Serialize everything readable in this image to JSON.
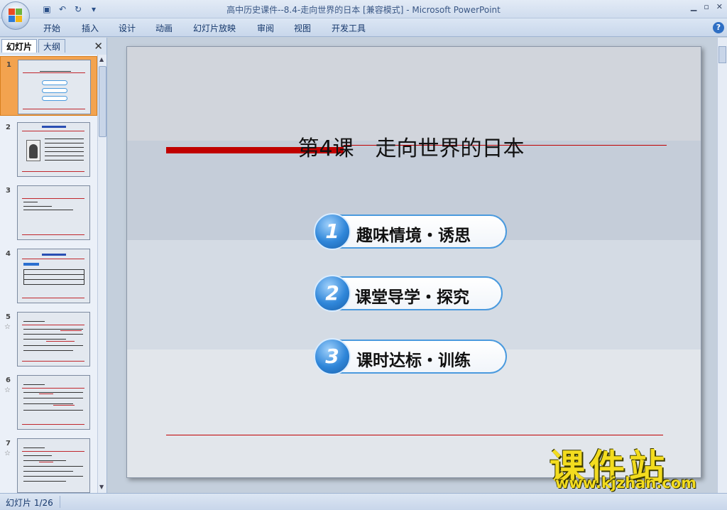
{
  "window": {
    "title": "高中历史课件--8.4-走向世界的日本 [兼容模式] - Microsoft PowerPoint"
  },
  "ribbon": {
    "tabs": [
      "开始",
      "插入",
      "设计",
      "动画",
      "幻灯片放映",
      "审阅",
      "视图",
      "开发工具"
    ]
  },
  "panel": {
    "tab_slides": "幻灯片",
    "tab_outline": "大纲",
    "close": "✕",
    "thumbnails": [
      {
        "num": "1",
        "star": ""
      },
      {
        "num": "2",
        "star": ""
      },
      {
        "num": "3",
        "star": ""
      },
      {
        "num": "4",
        "star": ""
      },
      {
        "num": "5",
        "star": "☆"
      },
      {
        "num": "6",
        "star": "☆"
      },
      {
        "num": "7",
        "star": "☆"
      }
    ]
  },
  "slide": {
    "title": "第4课　走向世界的日本",
    "items": [
      {
        "num": "1",
        "label": "趣味情境・诱思"
      },
      {
        "num": "2",
        "label": "课堂导学・探究"
      },
      {
        "num": "3",
        "label": "课时达标・训练"
      }
    ]
  },
  "watermark": {
    "name": "课件站",
    "url": "www.kjzhan.com"
  },
  "status": {
    "slide_counter": "幻灯片 1/26"
  }
}
